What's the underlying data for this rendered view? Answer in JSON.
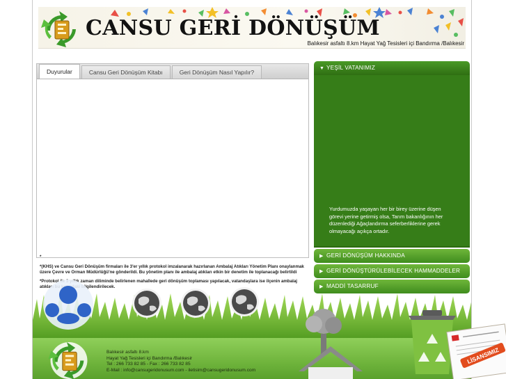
{
  "header": {
    "brand": "CANSU GERİ DÖNÜŞÜM",
    "address": "Balıkesir asfaltı 8.km Hayat Yağ Tesisleri içi   Bandırma /Balıkesir"
  },
  "tabs": [
    {
      "label": "Duyurular"
    },
    {
      "label": "Cansu Geri Dönüşüm Kitabı"
    },
    {
      "label": "Geri Dönüşüm Nasıl Yapılır?"
    }
  ],
  "news": {
    "bullet": "*",
    "p1": "*(KHS) ve Cansu Geri Dönüşüm firmaları ile 3'er yıllık protokol imzalanarak hazırlanan Ambalaj Atıkları Yönetim Planı onaylanmak üzere Çevre ve Orman Müdürlüğü'ne gönderildi. Bu yönetim planı ile ambalaj atıkları etkin bir denetim ile toplanacağı belirtildi",
    "p2": "*Protokol ile 3 yıllık zaman diliminde belirlenen mahallede geri dönüşüm toplaması yapılacak, vatandaşlara ise ilçenin ambalaj atıkları bu konudaki bilgilendirilecek."
  },
  "accordion": {
    "items": [
      {
        "label": "YEŞİL VATANIMIZ",
        "open": true
      },
      {
        "label": "GERİ DÖNÜŞÜM HAKKINDA"
      },
      {
        "label": "GERİ DÖNÜŞTÜRÜLEBİLECEK HAMMADDELER"
      },
      {
        "label": "MADDİ TASARRUF"
      }
    ],
    "open_text": "Yurdumuzda yaşayan her bir birey üzerine düşen görevi yerine getirmiş olsa, Tarım bakanlığının her düzenlediği Ağaçlandırma seferberliklerine gerek olmayacağı açıkça ortadır."
  },
  "footer": {
    "line1": "Balıkesir asfaltı 8.km",
    "line2": "Hayat Yağ Tesisleri içi   Bandırma /Balıkesir",
    "line3": "Tel : 266 733 82 85  -  Fax : 266 733 82 85",
    "line4": "E-Mail : info@cansugeridonusum.com  -  iletisim@cansugeridonusum.com"
  },
  "badge": {
    "text": "LİSANSIMIZ"
  },
  "icons": [
    "recycle-logo-icon",
    "people-icon",
    "globe-icon",
    "tree-icon",
    "house-icon",
    "recycle-bin-icon",
    "certificate-icon"
  ],
  "colors": {
    "accent_green": "#3f8d1e",
    "panel_green": "#367d18",
    "footer_green": "#6fb43c"
  }
}
